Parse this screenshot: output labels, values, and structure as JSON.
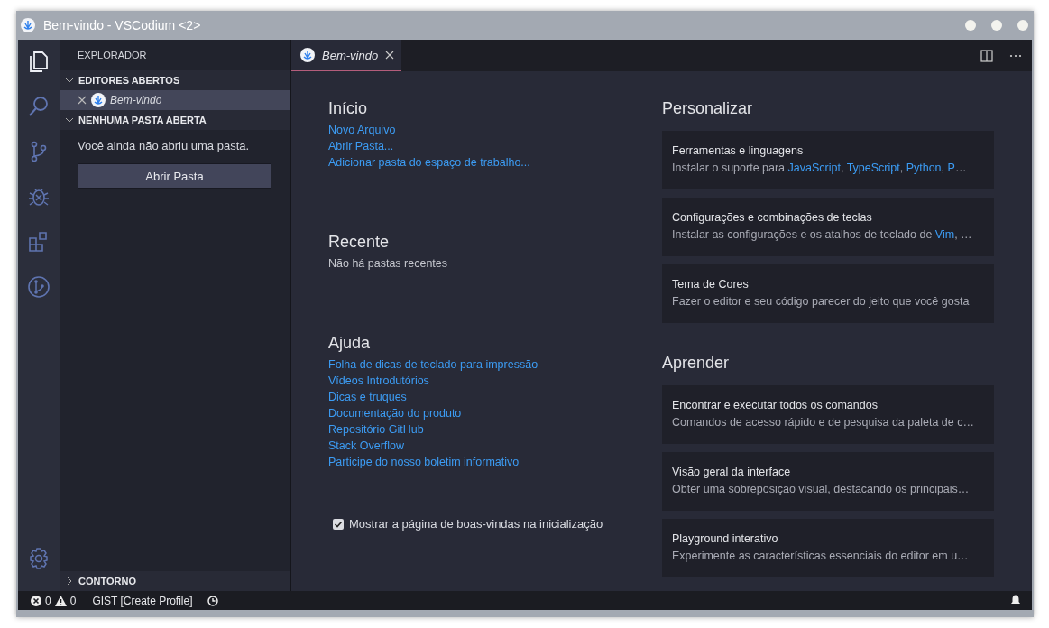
{
  "window": {
    "title": "Bem-vindo - VSCodium <2>"
  },
  "activity_bar": {
    "items": [
      {
        "kind": "files",
        "selected": true
      },
      {
        "kind": "search",
        "selected": false
      },
      {
        "kind": "branch",
        "selected": false
      },
      {
        "kind": "bug",
        "selected": false
      },
      {
        "kind": "extensions",
        "selected": false
      },
      {
        "kind": "remote",
        "selected": false
      }
    ],
    "bottom": [
      {
        "kind": "gear",
        "selected": false
      }
    ]
  },
  "sidebar": {
    "title": "EXPLORADOR",
    "sections": [
      {
        "kind": "editors",
        "title": "EDITORES ABERTOS",
        "expanded": true,
        "items": [
          {
            "label": "Bem-vindo",
            "selected": true
          }
        ]
      },
      {
        "kind": "empty",
        "title": "NENHUMA PASTA ABERTA",
        "expanded": true,
        "message": "Você ainda não abriu uma pasta.",
        "button": "Abrir Pasta"
      },
      {
        "title": "CONTORNO",
        "expanded": false
      }
    ]
  },
  "tabs": [
    {
      "label": "Bem-vindo",
      "selected": true
    }
  ],
  "welcome": {
    "left": [
      {
        "kind": "links",
        "heading": "Início",
        "links": [
          "Novo Arquivo",
          "Abrir Pasta...",
          "Adicionar pasta do espaço de trabalho..."
        ]
      },
      {
        "kind": "text",
        "heading": "Recente",
        "text": "Não há pastas recentes"
      },
      {
        "kind": "links",
        "heading": "Ajuda",
        "links": [
          "Folha de dicas de teclado para impressão",
          "Vídeos Introdutórios",
          "Dicas e truques",
          "Documentação do produto",
          "Repositório GitHub",
          "Stack Overflow",
          "Participe do nosso boletim informativo"
        ]
      }
    ],
    "show_on_startup": {
      "label": "Mostrar a página de boas-vindas na inicialização",
      "checked": true
    },
    "right": [
      {
        "heading": "Personalizar",
        "cards": [
          {
            "title": "Ferramentas e linguagens",
            "description": [
              {
                "text": "Instalar o suporte para ",
                "link": false
              },
              {
                "text": "JavaScript",
                "link": true
              },
              {
                "text": ", ",
                "link": false
              },
              {
                "text": "TypeScript",
                "link": true
              },
              {
                "text": ", ",
                "link": false
              },
              {
                "text": "Python",
                "link": true
              },
              {
                "text": ", ",
                "link": false
              },
              {
                "text": "P",
                "link": true
              },
              {
                "text": "…",
                "link": false
              }
            ]
          },
          {
            "title": "Configurações e combinações de teclas",
            "description": [
              {
                "text": "Instalar as configurações e os atalhos de teclado de ",
                "link": false
              },
              {
                "text": "Vim",
                "link": true
              },
              {
                "text": ", …",
                "link": false
              }
            ]
          },
          {
            "title": "Tema de Cores",
            "description": [
              {
                "text": "Fazer o editor e seu código parecer do jeito que você gosta",
                "link": false
              }
            ]
          }
        ]
      },
      {
        "heading": "Aprender",
        "cards": [
          {
            "title": "Encontrar e executar todos os comandos",
            "description": [
              {
                "text": "Comandos de acesso rápido e de pesquisa da paleta de c…",
                "link": false
              }
            ]
          },
          {
            "title": "Visão geral da interface",
            "description": [
              {
                "text": "Obter uma sobreposição visual, destacando os principais…",
                "link": false
              }
            ]
          },
          {
            "title": "Playground interativo",
            "description": [
              {
                "text": "Experimente as características essenciais do editor em u…",
                "link": false
              }
            ]
          }
        ]
      }
    ]
  },
  "status_bar": {
    "errors": "0",
    "warnings": "0",
    "gist": "GIST [Create Profile]"
  }
}
